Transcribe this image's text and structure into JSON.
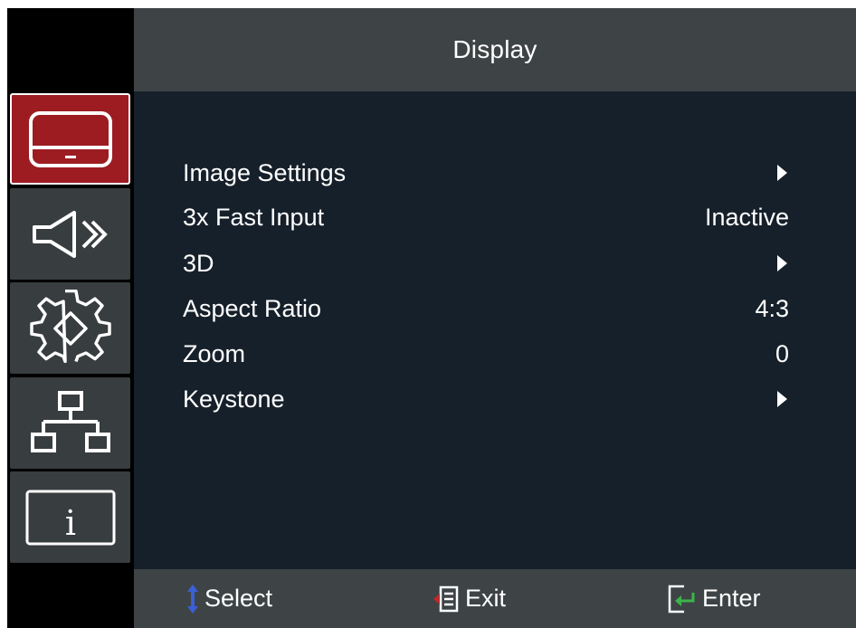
{
  "title": "Display",
  "sidebar": {
    "tabs": [
      {
        "icon": "display-icon",
        "active": true
      },
      {
        "icon": "audio-icon",
        "active": false
      },
      {
        "icon": "gear-icon",
        "active": false
      },
      {
        "icon": "network-icon",
        "active": false
      },
      {
        "icon": "info-icon",
        "active": false
      }
    ]
  },
  "menu": {
    "items": [
      {
        "label": "Image Settings",
        "value": "",
        "submenu": true
      },
      {
        "label": "3x Fast Input",
        "value": "Inactive",
        "submenu": false
      },
      {
        "label": "3D",
        "value": "",
        "submenu": true
      },
      {
        "label": "Aspect Ratio",
        "value": "4:3",
        "submenu": false
      },
      {
        "label": "Zoom",
        "value": "0",
        "submenu": false
      },
      {
        "label": "Keystone",
        "value": "",
        "submenu": true
      }
    ]
  },
  "footer": {
    "select_label": "Select",
    "exit_label": "Exit",
    "enter_label": "Enter"
  },
  "colors": {
    "active_tab": "#9c1c22",
    "title_bar": "#3e4446",
    "content_bg": "#16202a",
    "select_arrow": "#3a5fd6",
    "exit_arrow": "#c0282c",
    "enter_arrow": "#3cb44a"
  }
}
